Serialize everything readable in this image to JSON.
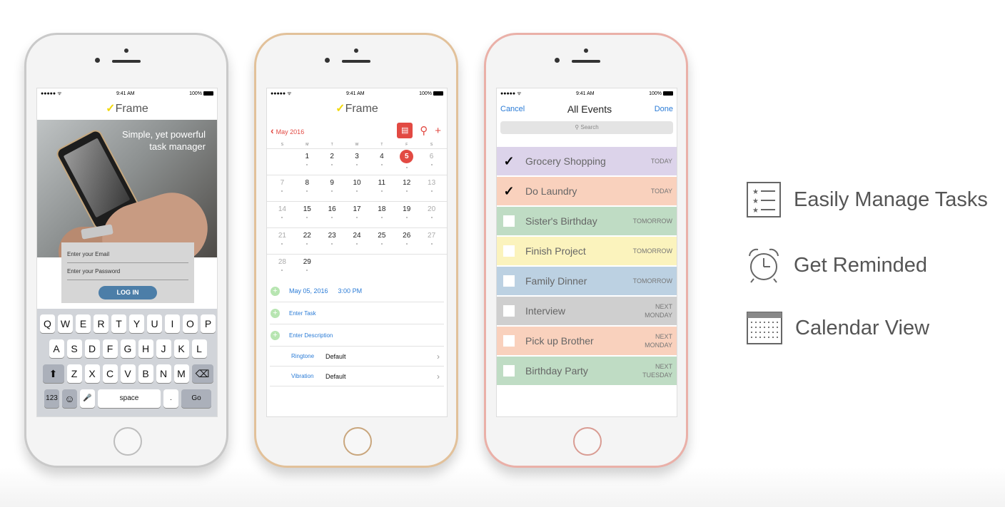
{
  "status": {
    "signal": "●●●●● ᯤ",
    "time": "9:41 AM",
    "battery": "100%"
  },
  "brand": {
    "check": "✓",
    "name": "Frame"
  },
  "login": {
    "tagline_1": "Simple, yet powerful",
    "tagline_2": "task manager",
    "email_placeholder": "Enter your Email",
    "password_placeholder": "Enter your Password",
    "login_label": "LOG IN"
  },
  "keyboard": {
    "row1": [
      "Q",
      "W",
      "E",
      "R",
      "T",
      "Y",
      "U",
      "I",
      "O",
      "P"
    ],
    "row2": [
      "A",
      "S",
      "D",
      "F",
      "G",
      "H",
      "J",
      "K",
      "L"
    ],
    "row3": [
      "Z",
      "X",
      "C",
      "V",
      "B",
      "N",
      "M"
    ],
    "shift": "⬆",
    "backspace": "⌫",
    "numbers": "123",
    "emoji": "☺",
    "mic": "🎤",
    "space": "space",
    "period": ".",
    "go": "Go"
  },
  "calendar": {
    "back_label": "May 2016",
    "days_of_week": [
      "S",
      "M",
      "T",
      "W",
      "T",
      "F",
      "S"
    ],
    "weeks": [
      [
        "",
        "1",
        "2",
        "3",
        "4",
        "5",
        "6"
      ],
      [
        "7",
        "8",
        "9",
        "10",
        "11",
        "12",
        "13"
      ],
      [
        "14",
        "15",
        "16",
        "17",
        "18",
        "19",
        "20"
      ],
      [
        "21",
        "22",
        "23",
        "24",
        "25",
        "26",
        "27"
      ],
      [
        "28",
        "29",
        "",
        "",
        "",
        "",
        ""
      ]
    ],
    "today": "5",
    "date_value": "May 05, 2016",
    "time_value": "3:00 PM",
    "task_placeholder": "Enter Task",
    "description_placeholder": "Enter Description",
    "ringtone_label": "Ringtone",
    "ringtone_value": "Default",
    "vibration_label": "Vibration",
    "vibration_value": "Default"
  },
  "events": {
    "cancel": "Cancel",
    "title": "All Events",
    "done": "Done",
    "search_placeholder": "Search",
    "items": [
      {
        "name": "Grocery Shopping",
        "when1": "TODAY",
        "when2": "",
        "checked": true,
        "color": "#dcd3ea"
      },
      {
        "name": "Do Laundry",
        "when1": "TODAY",
        "when2": "",
        "checked": true,
        "color": "#f9d1bd"
      },
      {
        "name": "Sister's Birthday",
        "when1": "TOMORROW",
        "when2": "",
        "checked": false,
        "color": "#bfdcc4"
      },
      {
        "name": "Finish Project",
        "when1": "TOMORROW",
        "when2": "",
        "checked": false,
        "color": "#fbf3bd"
      },
      {
        "name": "Family Dinner",
        "when1": "TOMORROW",
        "when2": "",
        "checked": false,
        "color": "#bcd1e2"
      },
      {
        "name": "Interview",
        "when1": "NEXT",
        "when2": "MONDAY",
        "checked": false,
        "color": "#cfcfcf"
      },
      {
        "name": "Pick up Brother",
        "when1": "NEXT",
        "when2": "MONDAY",
        "checked": false,
        "color": "#f9d1bd"
      },
      {
        "name": "Birthday Party",
        "when1": "NEXT",
        "when2": "TUESDAY",
        "checked": false,
        "color": "#bfdcc4"
      }
    ]
  },
  "features": [
    {
      "label": "Easily Manage Tasks",
      "icon": "task-list-icon"
    },
    {
      "label": "Get Reminded",
      "icon": "alarm-clock-icon"
    },
    {
      "label": "Calendar View",
      "icon": "calendar-icon"
    }
  ]
}
